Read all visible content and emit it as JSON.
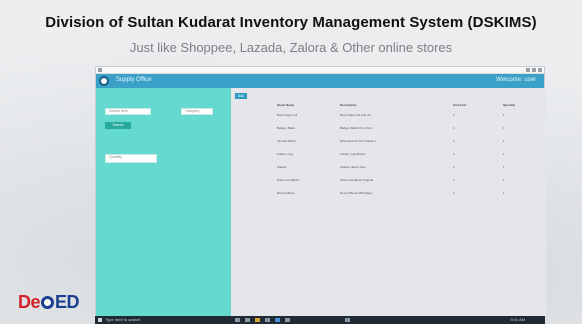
{
  "slide": {
    "heading": "Division of Sultan Kudarat Inventory Management System (DSKIMS)",
    "subheading": "Just like Shoppee, Lazada, Zalora & Other online stores",
    "logo_parts": [
      "De",
      "ED"
    ]
  },
  "app": {
    "title": "Supply Office",
    "welcome": "Welcome: user",
    "sidebar": {
      "search_placeholder": "Search item",
      "select_value": "Category",
      "search_button": "Search",
      "extra_input": "Quantity"
    },
    "main_button": "Add",
    "table": {
      "columns": [
        "Stock Name",
        "Description",
        "Unit Cost",
        "Quantity"
      ],
      "rows": [
        [
          "Bond Paper A4",
          "Bond Paper A4 Sub 20",
          "1",
          "1"
        ],
        [
          "Ballpen Black",
          "Ballpen Black Fine Point",
          "1",
          "1"
        ],
        [
          "Alcohol 500ml",
          "Ethyl Alcohol 70% Solution",
          "1",
          "1"
        ],
        [
          "Folder Long",
          "Folder Long Brown",
          "1",
          "1"
        ],
        [
          "Stapler",
          "Stapler Heavy Duty",
          "1",
          "1"
        ],
        [
          "Printer Ink Black",
          "Printer Ink Black Original",
          "1",
          "1"
        ],
        [
          "Record Book",
          "Record Book 300 Pages",
          "1",
          "1"
        ]
      ]
    }
  },
  "taskbar": {
    "search_text": "Type here to search",
    "clock": "9:41 AM"
  },
  "colors": {
    "titlebar": "#3aa0c8",
    "sidebar": "#64d9d0",
    "accent_button": "#27a99c"
  }
}
